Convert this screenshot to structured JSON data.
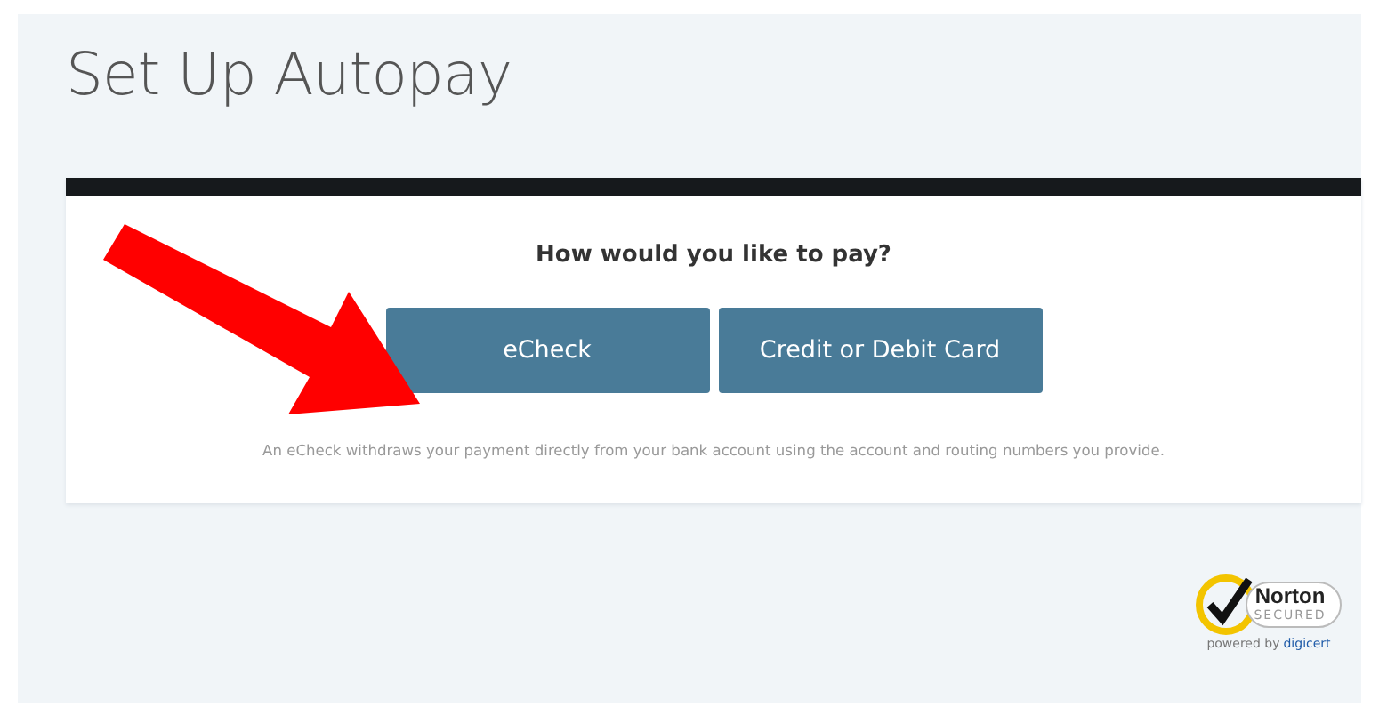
{
  "page": {
    "title": "Set Up Autopay"
  },
  "payment": {
    "question": "How would you like to pay?",
    "options": [
      {
        "label": "eCheck"
      },
      {
        "label": "Credit or Debit Card"
      }
    ],
    "note": "An eCheck withdraws your payment directly from your bank account using the account and routing numbers you provide."
  },
  "badge": {
    "brand": "Norton",
    "status": "SECURED",
    "powered_by": "powered by",
    "provider": "digicert"
  }
}
